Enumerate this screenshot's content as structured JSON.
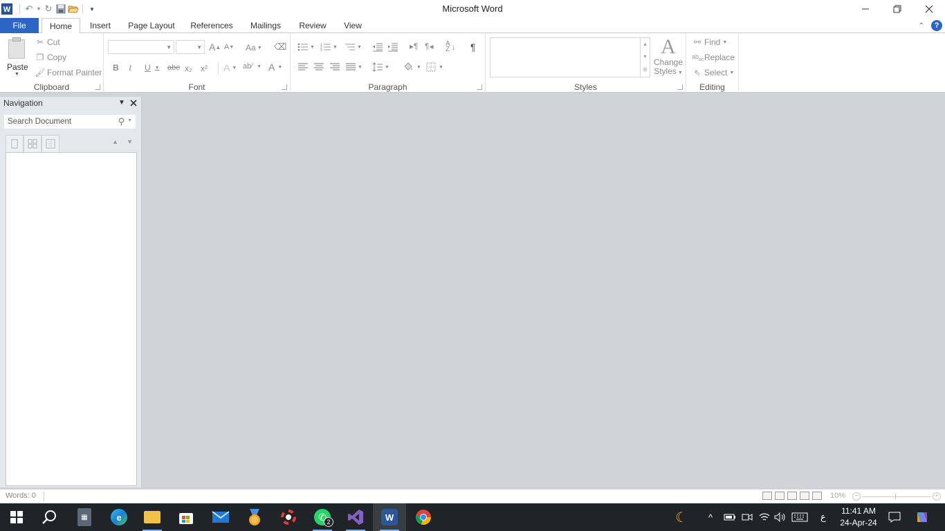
{
  "window": {
    "title": "Microsoft Word"
  },
  "qat": {
    "icons": [
      "word-logo-icon",
      "undo-icon",
      "redo-icon",
      "save-icon",
      "open-icon",
      "customize-icon"
    ]
  },
  "tabs": {
    "file": "File",
    "home": "Home",
    "insert": "Insert",
    "page_layout": "Page Layout",
    "references": "References",
    "mailings": "Mailings",
    "review": "Review",
    "view": "View"
  },
  "ribbon": {
    "clipboard": {
      "label": "Clipboard",
      "paste": "Paste",
      "cut": "Cut",
      "copy": "Copy",
      "format_painter": "Format Painter"
    },
    "font": {
      "label": "Font",
      "bold": "B",
      "italic": "I",
      "underline": "U",
      "strike": "abe",
      "sub": "x₂",
      "sup": "x²",
      "grow": "A",
      "shrink": "A",
      "case": "Aa",
      "font_color": "A"
    },
    "paragraph": {
      "label": "Paragraph",
      "show_marks": "¶"
    },
    "styles": {
      "label": "Styles",
      "change_styles_line1": "Change",
      "change_styles_line2": "Styles"
    },
    "editing": {
      "label": "Editing",
      "find": "Find",
      "replace": "Replace",
      "select": "Select"
    }
  },
  "navigation": {
    "title": "Navigation",
    "search_placeholder": "Search Document"
  },
  "statusbar": {
    "words": "Words: 0",
    "zoom": "10%"
  },
  "taskbar": {
    "apps": [
      "windows-start",
      "search",
      "calculator",
      "edge",
      "file-explorer",
      "microsoft-store",
      "mail",
      "achievement",
      "antivirus",
      "whatsapp",
      "visual-studio",
      "word",
      "chrome"
    ],
    "whatsapp_badge": "2",
    "time": "11:41 AM",
    "date": "24-Apr-24",
    "lang": "ع"
  }
}
